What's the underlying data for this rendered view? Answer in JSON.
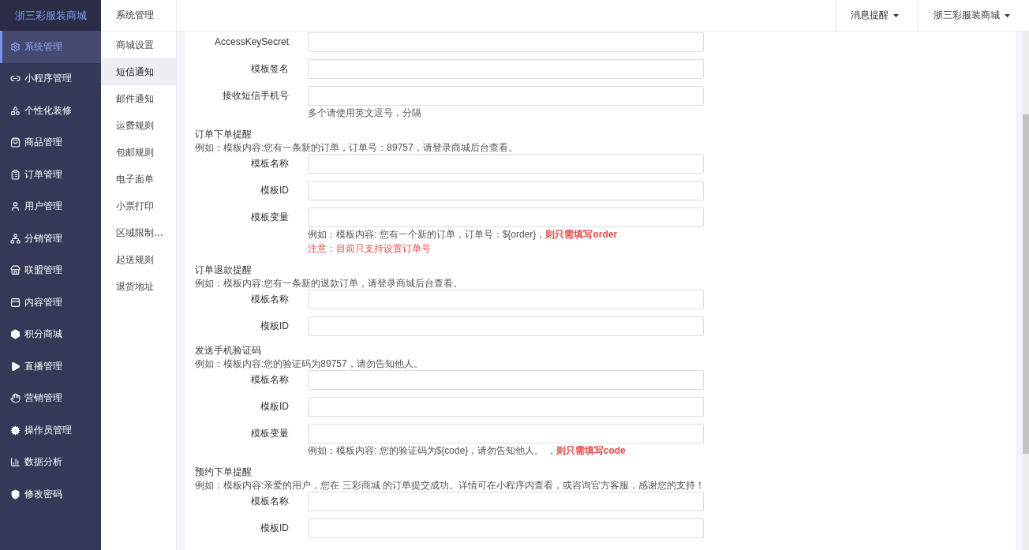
{
  "brand": "浙三彩服装商城",
  "sidebar": {
    "items": [
      {
        "label": "系统管理",
        "selected": true
      },
      {
        "label": "小程序管理",
        "selected": false
      },
      {
        "label": "个性化装修",
        "selected": false
      },
      {
        "label": "商品管理",
        "selected": false
      },
      {
        "label": "订单管理",
        "selected": false
      },
      {
        "label": "用户管理",
        "selected": false
      },
      {
        "label": "分销管理",
        "selected": false
      },
      {
        "label": "联盟管理",
        "selected": false
      },
      {
        "label": "内容管理",
        "selected": false
      },
      {
        "label": "积分商城",
        "selected": false
      },
      {
        "label": "直播管理",
        "selected": false
      },
      {
        "label": "营销管理",
        "selected": false
      },
      {
        "label": "操作员管理",
        "selected": false
      },
      {
        "label": "数据分析",
        "selected": false
      },
      {
        "label": "修改密码",
        "selected": false
      }
    ]
  },
  "submenu": {
    "title": "系统管理",
    "items": [
      {
        "label": "商城设置",
        "selected": false
      },
      {
        "label": "短信通知",
        "selected": true
      },
      {
        "label": "邮件通知",
        "selected": false
      },
      {
        "label": "运费规则",
        "selected": false
      },
      {
        "label": "包邮规则",
        "selected": false
      },
      {
        "label": "电子面单",
        "selected": false
      },
      {
        "label": "小票打印",
        "selected": false
      },
      {
        "label": "区域限制…",
        "selected": false
      },
      {
        "label": "起送规则",
        "selected": false
      },
      {
        "label": "退货地址",
        "selected": false
      }
    ]
  },
  "topbar": {
    "menus": [
      "消息提醒",
      "浙三彩服装商城"
    ]
  },
  "sections": [
    {
      "fields": [
        {
          "label": "AccessKeySecret"
        },
        {
          "label": "模板签名"
        },
        {
          "label": "接收短信手机号",
          "notes": [
            {
              "text": "多个请使用英文逗号，分隔",
              "kind": "hint"
            }
          ]
        }
      ]
    },
    {
      "title": "订单下单提醒",
      "example": "例如：模板内容:您有一条新的订单，订单号：89757，请登录商城后台查看。",
      "fields": [
        {
          "label": "模板名称"
        },
        {
          "label": "模板ID"
        },
        {
          "label": "模板变量",
          "notes": [
            {
              "text": "例如：模板内容: 您有一个新的订单，订单号：${order}，**则只需填写order**",
              "kind": "hint"
            },
            {
              "text": "注意：目前只支持设置订单号",
              "kind": "warning"
            }
          ]
        }
      ]
    },
    {
      "title": "订单退款提醒",
      "example": "例如：模板内容:您有一条新的退款订单，请登录商城后台查看。",
      "fields": [
        {
          "label": "模板名称"
        },
        {
          "label": "模板ID"
        }
      ]
    },
    {
      "title": "发送手机验证码",
      "example": "例如：模板内容:您的验证码为89757，请勿告知他人。",
      "fields": [
        {
          "label": "模板名称"
        },
        {
          "label": "模板ID"
        },
        {
          "label": "模板变量",
          "notes": [
            {
              "text": "例如：模板内容: 您的验证码为${code}，请勿告知他人。 ，**则只需填写code**",
              "kind": "hint"
            }
          ]
        }
      ]
    },
    {
      "title": "预约下单提醒",
      "example": "例如：模板内容:亲爱的用户，您在 三彩商城 的订单提交成功。详情可在小程序内查看，或咨询官方客服，感谢您的支持！",
      "fields": [
        {
          "label": "模板名称"
        },
        {
          "label": "模板ID"
        }
      ]
    }
  ]
}
